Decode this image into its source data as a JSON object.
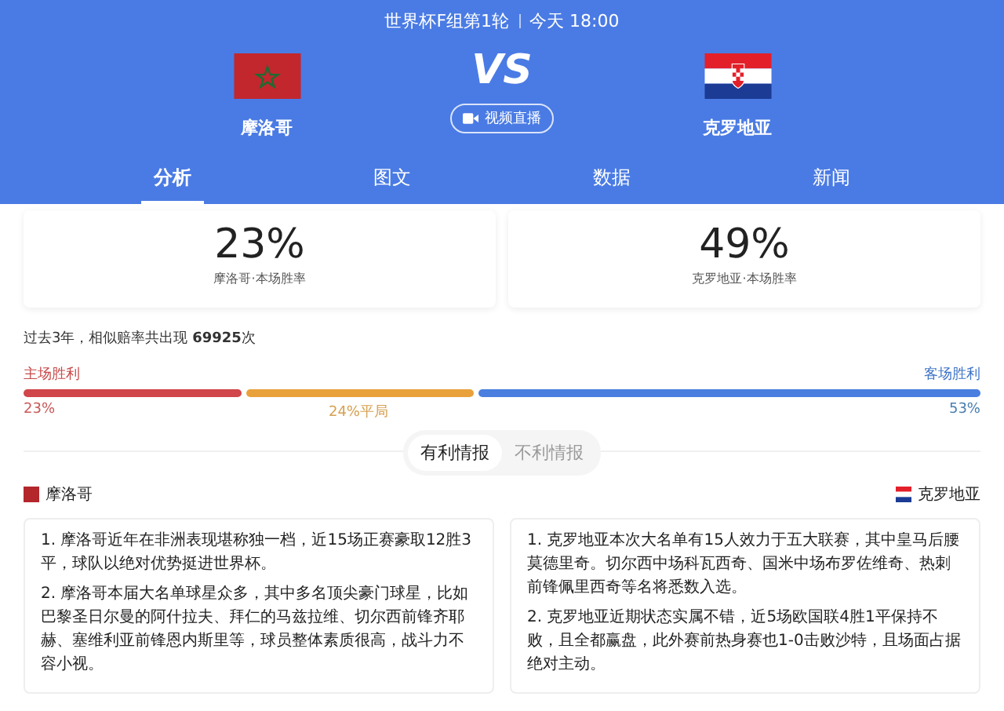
{
  "header": {
    "title": "世界杯F组第1轮",
    "time": "今天 18:00",
    "vs": "VS",
    "live_button": "视频直播",
    "teams": [
      {
        "name": "摩洛哥"
      },
      {
        "name": "克罗地亚"
      }
    ]
  },
  "tabs": [
    {
      "label": "分析",
      "selected": true
    },
    {
      "label": "图文",
      "selected": false
    },
    {
      "label": "数据",
      "selected": false
    },
    {
      "label": "新闻",
      "selected": false
    }
  ],
  "win_rates": [
    {
      "value": "23%",
      "label": "摩洛哥·本场胜率"
    },
    {
      "value": "49%",
      "label": "克罗地亚·本场胜率"
    }
  ],
  "history": {
    "prefix": "过去3年，相似赔率共出现 ",
    "count": "69925",
    "suffix": "次",
    "home_label": "主场胜利",
    "away_label": "客场胜利",
    "segments": [
      {
        "kind": "home",
        "reading": "23%"
      },
      {
        "kind": "draw",
        "reading": "24%平局"
      },
      {
        "kind": "away",
        "reading": "53%"
      }
    ]
  },
  "intel_tabs": [
    {
      "label": "有利情报",
      "selected": true
    },
    {
      "label": "不利情报",
      "selected": false
    }
  ],
  "intel": [
    {
      "team": "摩洛哥",
      "items": [
        "1. 摩洛哥近年在非洲表现堪称独一档，近15场正赛豪取12胜3平，球队以绝对优势挺进世界杯。",
        "2. 摩洛哥本届大名单球星众多，其中多名顶尖豪门球星，比如巴黎圣日尔曼的阿什拉夫、拜仁的马兹拉维、切尔西前锋齐耶赫、塞维利亚前锋恩内斯里等，球员整体素质很高，战斗力不容小视。"
      ]
    },
    {
      "team": "克罗地亚",
      "items": [
        "1. 克罗地亚本次大名单有15人效力于五大联赛，其中皇马后腰莫德里奇。切尔西中场科瓦西奇、国米中场布罗佐维奇、热刺前锋佩里西奇等名将悉数入选。",
        "2. 克罗地亚近期状态实属不错，近5场欧国联4胜1平保持不败，且全都赢盘，此外赛前热身赛也1-0击败沙特，且场面占据绝对主动。"
      ]
    }
  ]
}
